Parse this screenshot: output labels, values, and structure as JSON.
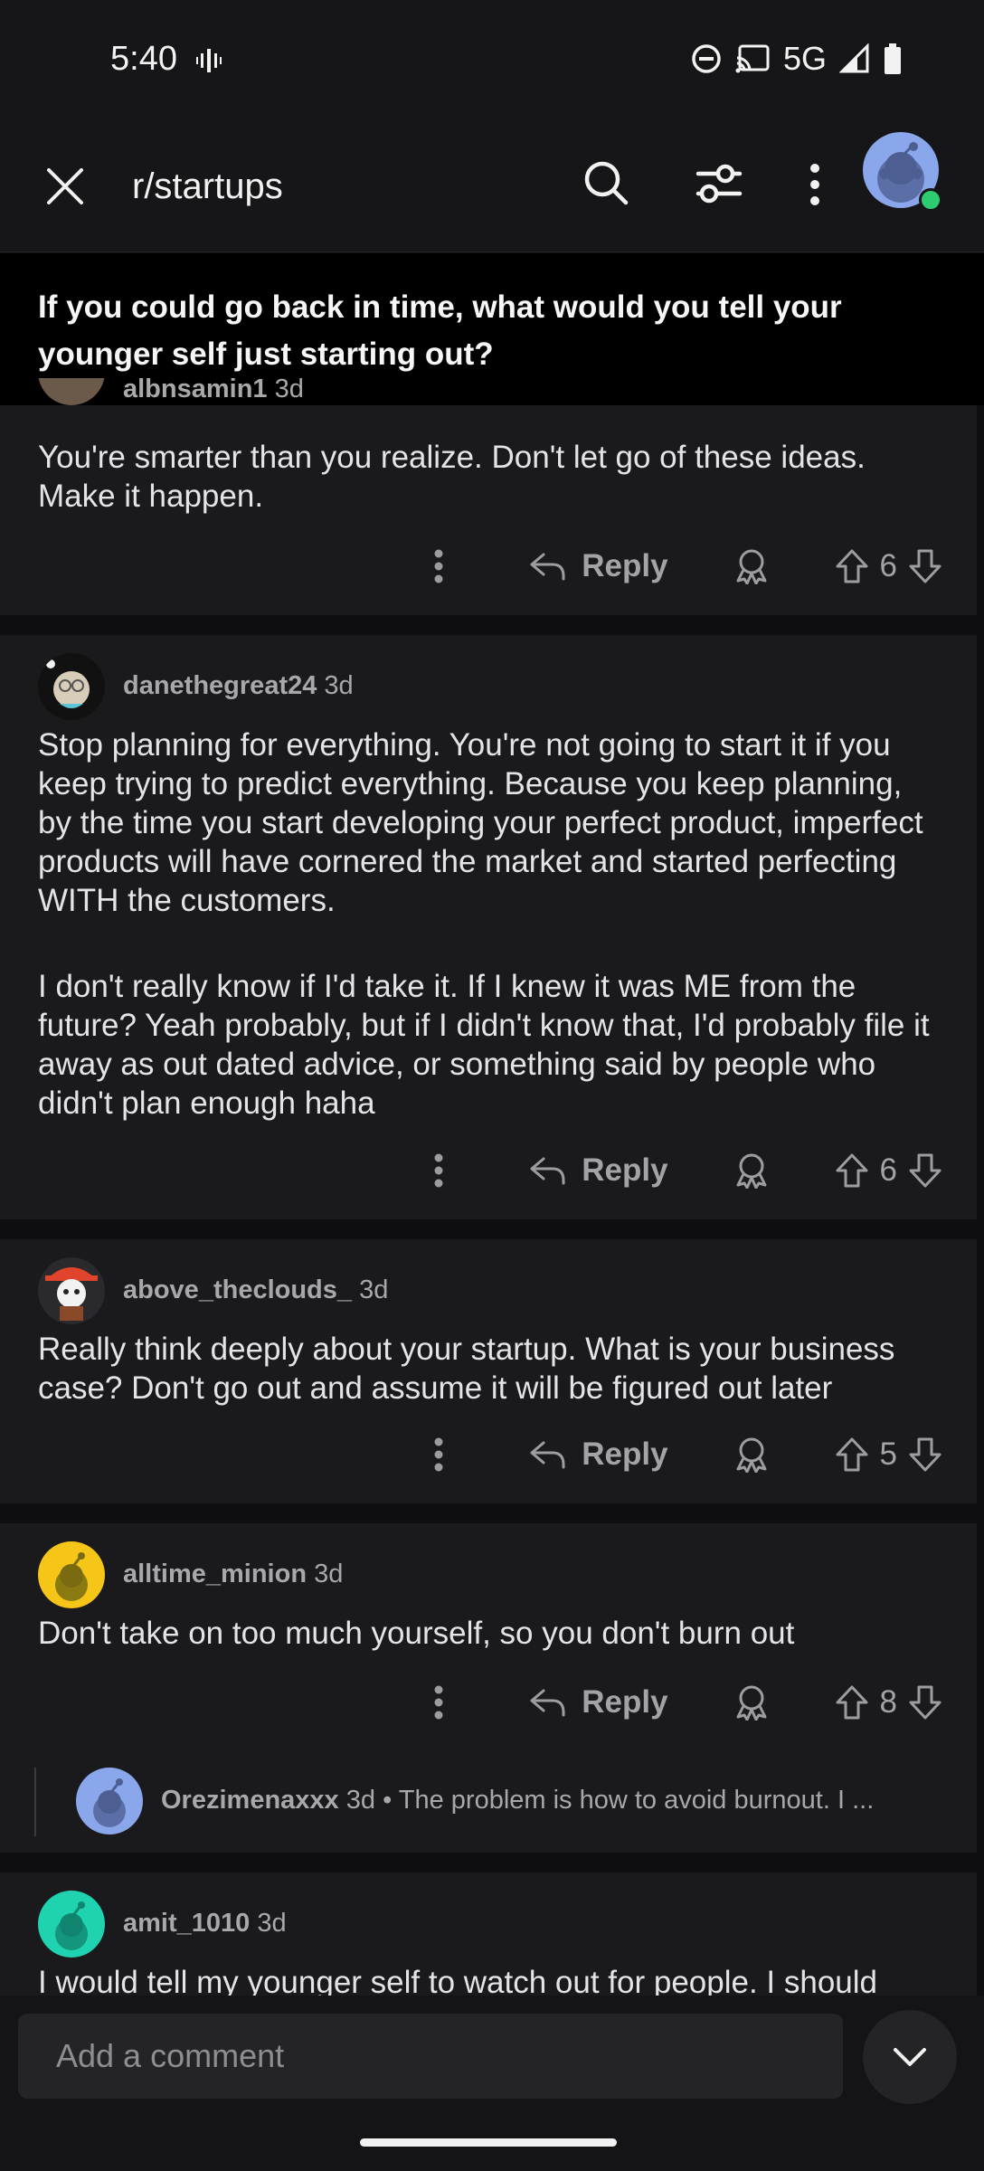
{
  "status": {
    "time": "5:40",
    "network": "5G"
  },
  "header": {
    "subreddit": "r/startups"
  },
  "post": {
    "title": "If you could go back in time, what would you tell your younger self just starting out?"
  },
  "comments": [
    {
      "author": "albnsamin1",
      "age": "3d",
      "body": [
        "You're smarter than you realize. Don't let go of these ideas. Make it happen."
      ],
      "reply_label": "Reply",
      "votes": "6"
    },
    {
      "author": "danethegreat24",
      "age": "3d",
      "body": [
        "Stop planning for everything. You're not going to start it if you keep trying to predict everything. Because you keep planning, by the time you start developing your perfect product, imperfect products will have cornered the market and started perfecting WITH the customers.",
        "I don't really know if I'd take it. If I knew it was ME from the future? Yeah probably, but if I didn't know that, I'd probably file it away as out dated advice, or something said by people who didn't plan enough haha"
      ],
      "reply_label": "Reply",
      "votes": "6"
    },
    {
      "author": "above_theclouds_",
      "age": "3d",
      "body": [
        "Really think deeply about your startup. What is your business case? Don't go out and assume it will be figured out later"
      ],
      "reply_label": "Reply",
      "votes": "5"
    },
    {
      "author": "alltime_minion",
      "age": "3d",
      "body": [
        "Don't take on too much yourself, so you don't burn out"
      ],
      "reply_label": "Reply",
      "votes": "8",
      "reply": {
        "author": "Orezimenaxxx",
        "age": "3d",
        "preview": "• The problem is how to avoid burnout. I ..."
      }
    },
    {
      "author": "amit_1010",
      "age": "3d",
      "body": [
        "I would tell my younger self to watch out for people. I should"
      ]
    }
  ],
  "composer": {
    "placeholder": "Add a comment"
  },
  "colors": {
    "background": "#0e0e10",
    "card": "#1a1a1c",
    "text": "#e4e4e6",
    "muted": "#a8a8ab",
    "online": "#2ecc71"
  }
}
